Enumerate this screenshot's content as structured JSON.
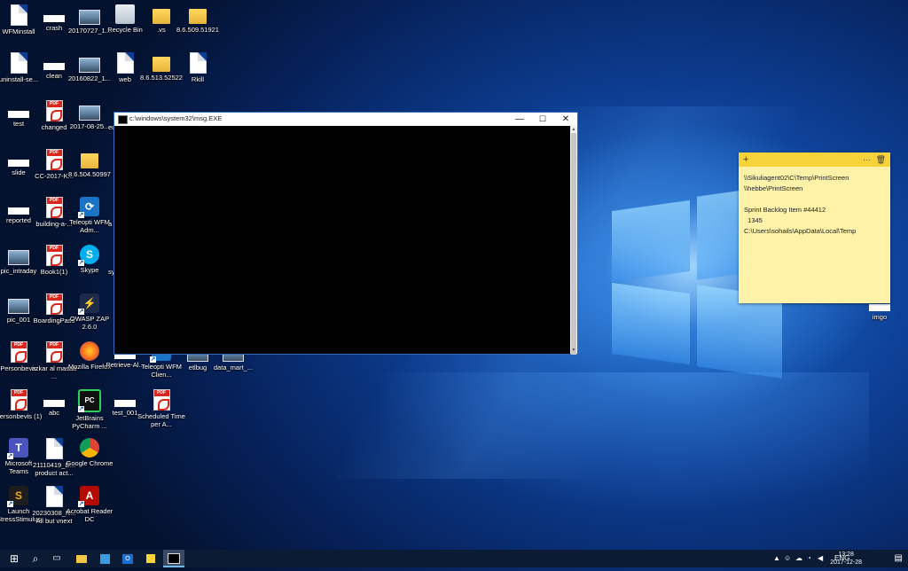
{
  "desktop": {
    "icons": [
      {
        "label": "WFMinstall",
        "kind": "doc"
      },
      {
        "label": "crash",
        "kind": "whitebar"
      },
      {
        "label": "20170727_1...",
        "kind": "thumb"
      },
      {
        "label": "Recycle Bin",
        "kind": "recycle"
      },
      {
        "label": ".vs",
        "kind": "folder"
      },
      {
        "label": "8.6.509.51921",
        "kind": "folder"
      },
      {
        "label": "uninstall-se...",
        "kind": "doc"
      },
      {
        "label": "clean",
        "kind": "whitebar"
      },
      {
        "label": "20160822_1...",
        "kind": "thumb"
      },
      {
        "label": "web",
        "kind": "doc"
      },
      {
        "label": "8.6.513.52522",
        "kind": "folder"
      },
      {
        "label": "Rkill",
        "kind": "doc"
      },
      {
        "label": "test",
        "kind": "whitebar"
      },
      {
        "label": "changed",
        "kind": "pdf"
      },
      {
        "label": "2017-08-25...",
        "kind": "thumb"
      },
      {
        "label": "slide",
        "kind": "whitebar"
      },
      {
        "label": "CC-2017-K...",
        "kind": "pdf"
      },
      {
        "label": "8.6.504.50997",
        "kind": "folder"
      },
      {
        "label": "reported",
        "kind": "whitebar"
      },
      {
        "label": "building-a-...",
        "kind": "pdf"
      },
      {
        "label": "Teleopti WFM Adm...",
        "kind": "teleopti"
      },
      {
        "label": "pic_intraday",
        "kind": "thumb"
      },
      {
        "label": "Book1(1)",
        "kind": "pdf"
      },
      {
        "label": "Skype",
        "kind": "skype"
      },
      {
        "label": "pic_001",
        "kind": "thumb"
      },
      {
        "label": "BoardingPass",
        "kind": "pdf"
      },
      {
        "label": "OWASP ZAP 2.6.0",
        "kind": "zap"
      },
      {
        "label": "Personbevis",
        "kind": "pdf"
      },
      {
        "label": "azkar al masaa ...",
        "kind": "pdf"
      },
      {
        "label": "Mozilla Firefox",
        "kind": "firefox"
      },
      {
        "label": "Retrieve-Al...",
        "kind": "whitebar"
      },
      {
        "label": "Teleopti WFM Clien...",
        "kind": "teleopti"
      },
      {
        "label": "etlbug",
        "kind": "thumb"
      },
      {
        "label": "data_mart_...",
        "kind": "thumb"
      },
      {
        "label": "Personbevis (1)",
        "kind": "pdf"
      },
      {
        "label": "abc",
        "kind": "whitebar"
      },
      {
        "label": "JetBrains PyCharm ...",
        "kind": "pycharm"
      },
      {
        "label": "test_001",
        "kind": "whitebar"
      },
      {
        "label": "Scheduled Time per A...",
        "kind": "pdf"
      },
      {
        "label": "Microsoft Teams",
        "kind": "teams"
      },
      {
        "label": "21110419_D... product act...",
        "kind": "doc"
      },
      {
        "label": "Google Chrome",
        "kind": "chrome"
      },
      {
        "label": "Launch StressStimulus",
        "kind": "stress"
      },
      {
        "label": "20230308_R... All but vnext",
        "kind": "doc"
      },
      {
        "label": "Acrobat Reader DC",
        "kind": "acrobat"
      },
      {
        "label": "imgo",
        "kind": "whitebar"
      },
      {
        "label": "ec F",
        "kind": "partial"
      },
      {
        "label": "a",
        "kind": "partial"
      },
      {
        "label": "sy",
        "kind": "partial"
      }
    ]
  },
  "console": {
    "title": "c:\\windows\\system32\\msg.EXE",
    "minimize": "—",
    "maximize": "☐",
    "close": "✕"
  },
  "sticky": {
    "add": "+",
    "menu": "···",
    "delete": "🗑",
    "lines": [
      "\\\\Sikuliagent02\\C\\Temp\\PrintScreen",
      "\\\\hebbe\\PrintScreen",
      "",
      "Sprint Backlog Item #44412",
      "  1345",
      "C:\\Users\\sohails\\AppData\\Local\\Temp"
    ]
  },
  "taskbar": {
    "start": "⊞",
    "search": "⌕",
    "taskview": "▭",
    "language": "ENG",
    "time": "13:28",
    "date": "2017-12-28"
  }
}
